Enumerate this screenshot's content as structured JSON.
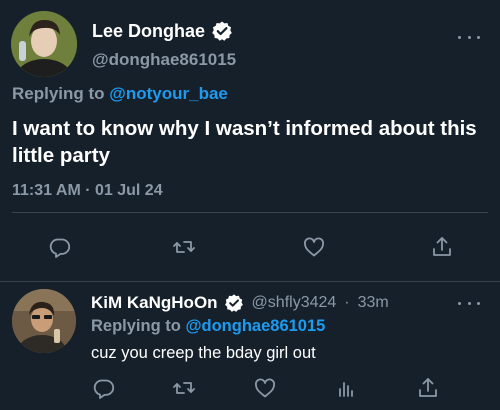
{
  "main_tweet": {
    "author": {
      "display_name": "Lee Donghae",
      "handle": "@donghae861015",
      "verified": true
    },
    "replying_prefix": "Replying to",
    "replying_to": "@notyour_bae",
    "text": "I want to know why I wasn’t informed about this little party",
    "timestamp": "11:31 AM · 01 Jul 24",
    "actions": [
      "reply-icon",
      "retweet-icon",
      "like-icon",
      "share-icon"
    ]
  },
  "reply_tweet": {
    "author": {
      "display_name": "KiM KaNgHoOn",
      "handle": "@shfly3424",
      "time_separator": "·",
      "time_ago": "33m",
      "verified": true
    },
    "replying_prefix": "Replying to",
    "replying_to": "@donghae861015",
    "text": "cuz you creep the bday girl out",
    "actions": [
      "reply-icon",
      "retweet-icon",
      "like-icon",
      "analytics-icon",
      "share-icon"
    ]
  },
  "colors": {
    "background": "#15202b",
    "primary_text": "#ffffff",
    "secondary_text": "#8b98a5",
    "accent": "#1d9bf0",
    "divider": "#38444d"
  }
}
